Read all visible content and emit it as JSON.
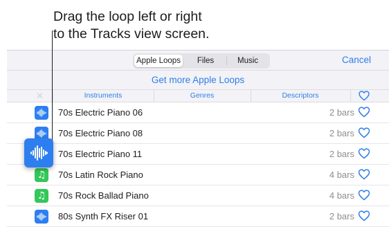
{
  "callout": {
    "line1": "Drag the loop left or right",
    "line2": "to the Tracks view screen."
  },
  "tabs": [
    {
      "label": "Apple Loops",
      "active": true
    },
    {
      "label": "Files",
      "active": false
    },
    {
      "label": "Music",
      "active": false
    }
  ],
  "cancel_label": "Cancel",
  "more_loops_label": "Get more Apple Loops",
  "filters": {
    "clear_glyph": "✕",
    "instruments": "Instruments",
    "genres": "Genres",
    "descriptors": "Descriptors"
  },
  "loops": [
    {
      "name": "70s Electric Piano 06",
      "length": "2 bars",
      "icon": "waveform-icon"
    },
    {
      "name": "70s Electric Piano 08",
      "length": "2 bars",
      "icon": "waveform-icon"
    },
    {
      "name": "70s Electric Piano 11",
      "length": "2 bars",
      "icon": "waveform-icon"
    },
    {
      "name": "70s Latin Rock Piano",
      "length": "4 bars",
      "icon": "music-note-icon"
    },
    {
      "name": "70s Rock Ballad Piano",
      "length": "4 bars",
      "icon": "music-note-icon"
    },
    {
      "name": "80s Synth FX Riser 01",
      "length": "2 bars",
      "icon": "waveform-icon"
    }
  ],
  "note_glyph": "♫",
  "colors": {
    "accent": "#2f7fe6",
    "audio_loop": "#2d7ff0",
    "midi_loop": "#34c759",
    "secondary_text": "#8e8e93"
  }
}
